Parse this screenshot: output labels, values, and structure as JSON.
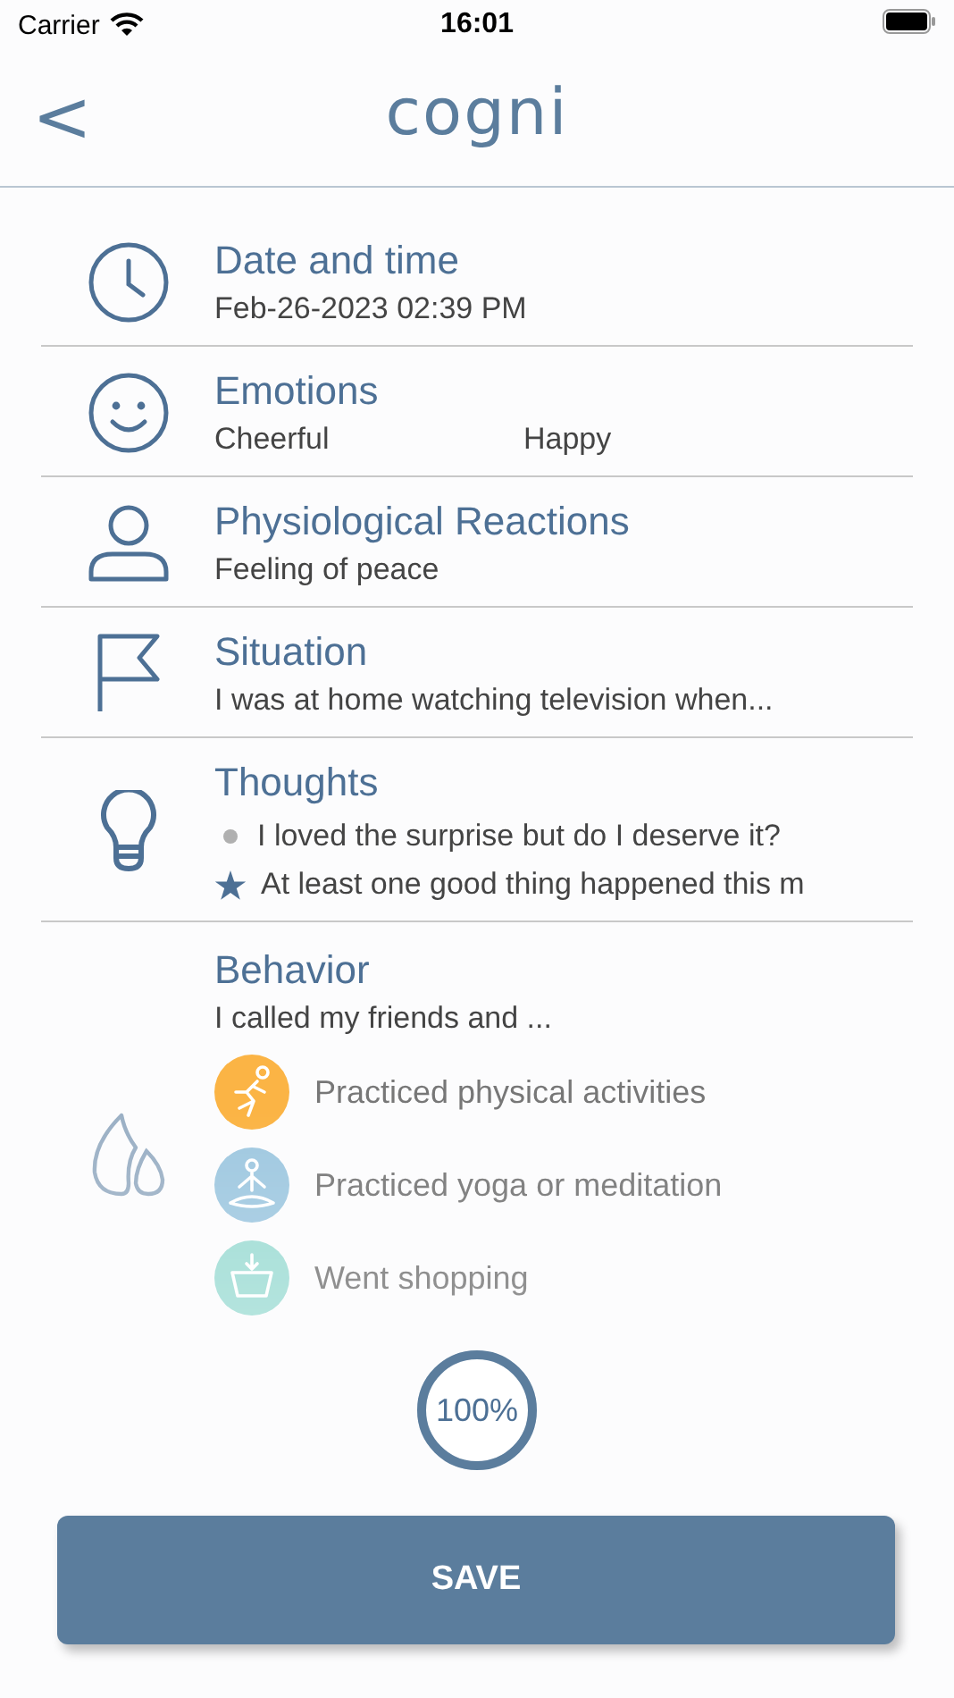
{
  "status_bar": {
    "carrier": "Carrier",
    "time": "16:01"
  },
  "nav": {
    "back": "<",
    "title": "cogni"
  },
  "sections": [
    {
      "kind": "clock",
      "title": "Date and time",
      "values": [
        "Feb-26-2023 02:39 PM"
      ]
    },
    {
      "kind": "smile",
      "title": "Emotions",
      "values": [
        "Cheerful",
        "Happy"
      ]
    },
    {
      "kind": "person",
      "title": "Physiological Reactions",
      "values": [
        "Feeling of peace"
      ]
    },
    {
      "kind": "flag",
      "title": "Situation",
      "values": [
        "I was at home watching television when..."
      ]
    },
    {
      "kind": "bulb",
      "title": "Thoughts",
      "thoughts": [
        {
          "kind": "bullet",
          "text": "I loved the surprise but do I deserve it?"
        },
        {
          "kind": "star",
          "text": "At least one good thing happened this m"
        }
      ]
    },
    {
      "kind": "flame",
      "title": "Behavior",
      "values": [
        "I called my friends and ..."
      ],
      "activities": [
        {
          "kind": "runner",
          "color": "#fbb445",
          "text": "Practiced physical activities"
        },
        {
          "kind": "yoga",
          "color": "#9fc8e0",
          "text": "Practiced yoga or meditation"
        },
        {
          "kind": "basket",
          "color": "#9edcd4",
          "text": "Went shopping"
        }
      ]
    }
  ],
  "progress": {
    "level": 1,
    "label": "100%"
  },
  "save_button": "SAVE"
}
